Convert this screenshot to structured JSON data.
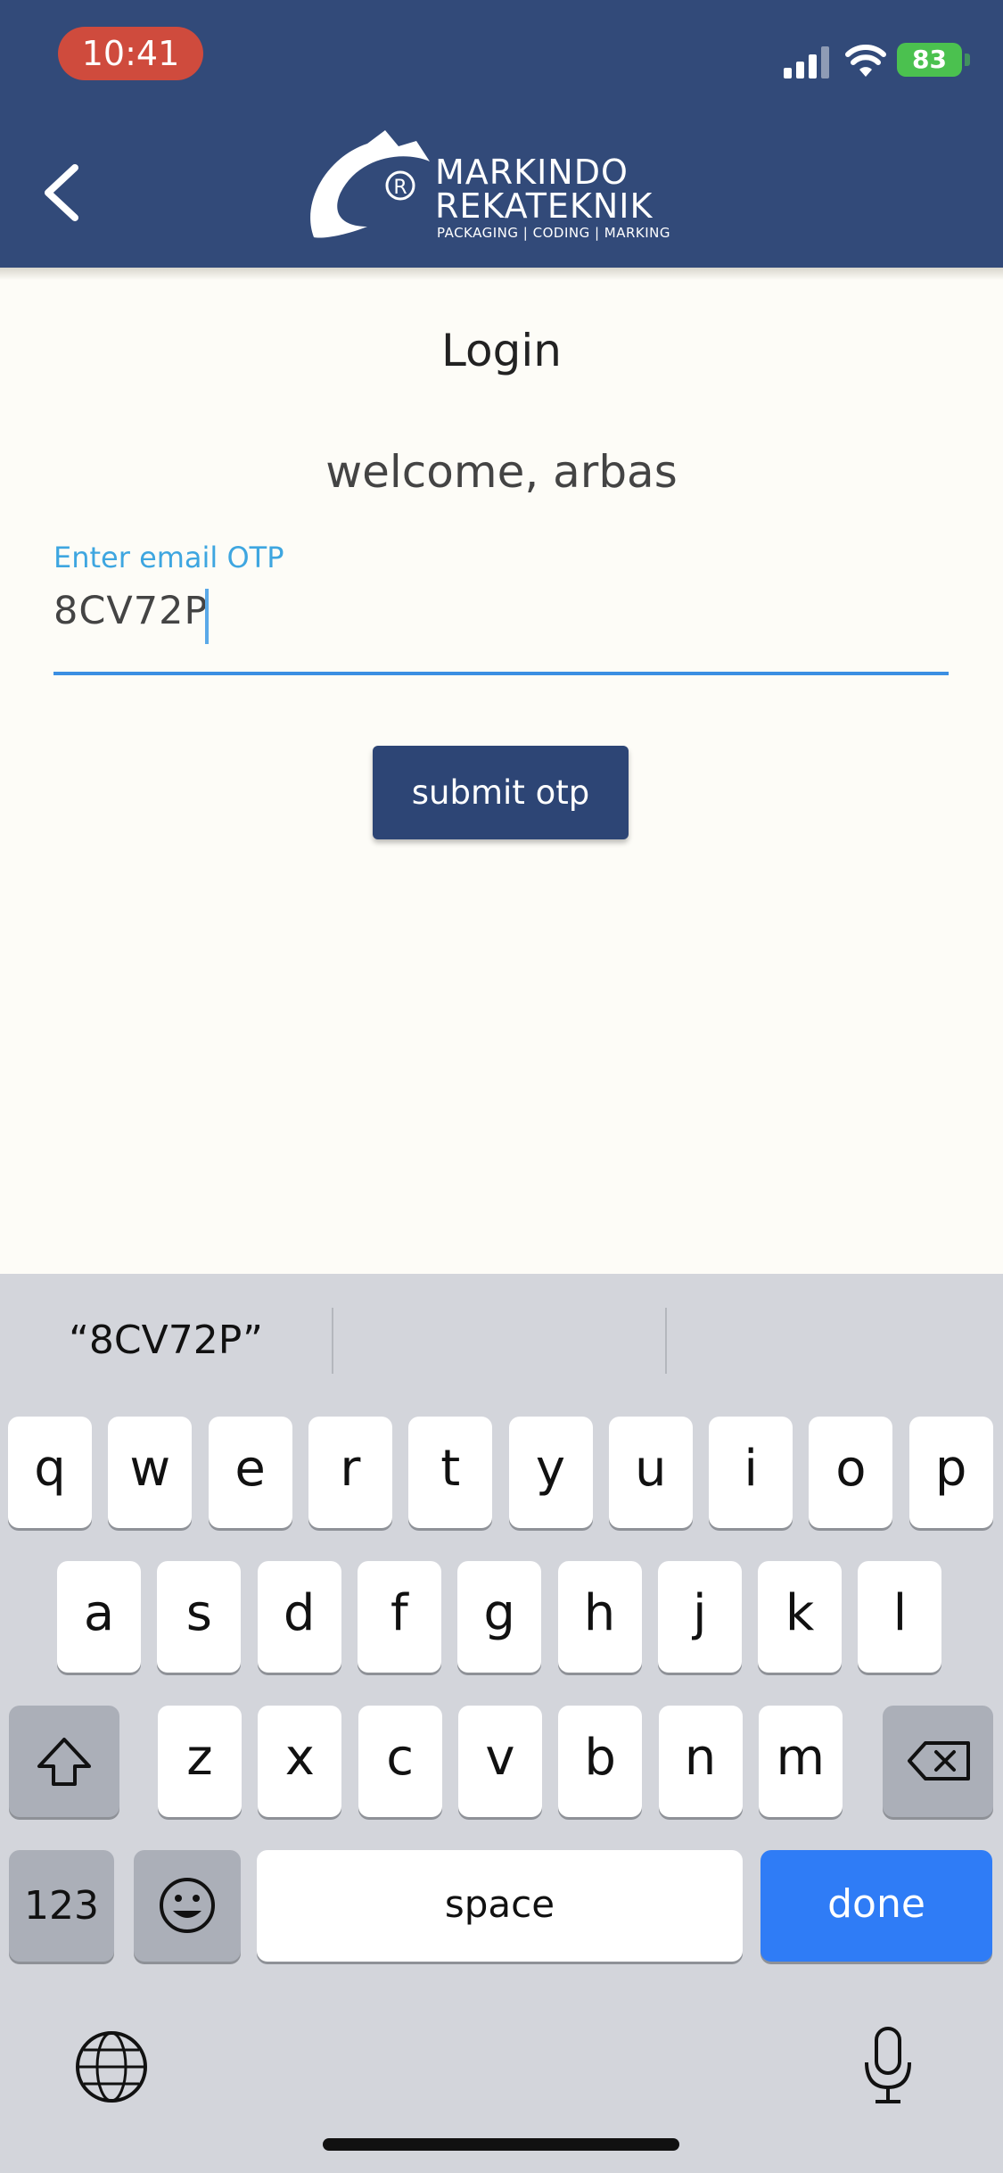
{
  "status_bar": {
    "time": "10:41",
    "battery": "83"
  },
  "header": {
    "brand_line1": "MARKINDO",
    "brand_line2": "REKATEKNIK",
    "brand_tagline": "PACKAGING | CODING | MARKING"
  },
  "login": {
    "title": "Login",
    "welcome": "welcome, arbas",
    "otp_label": "Enter email OTP",
    "otp_value": "8CV72P",
    "submit_label": "submit otp"
  },
  "keyboard": {
    "suggestion": "“8CV72P”",
    "row1": [
      "q",
      "w",
      "e",
      "r",
      "t",
      "y",
      "u",
      "i",
      "o",
      "p"
    ],
    "row2": [
      "a",
      "s",
      "d",
      "f",
      "g",
      "h",
      "j",
      "k",
      "l"
    ],
    "row3": [
      "z",
      "x",
      "c",
      "v",
      "b",
      "n",
      "m"
    ],
    "numbers_label": "123",
    "space_label": "space",
    "done_label": "done"
  },
  "colors": {
    "header": "#324a79",
    "accent": "#3b8fe2",
    "button": "#2d4575",
    "done": "#2f7cf6"
  }
}
